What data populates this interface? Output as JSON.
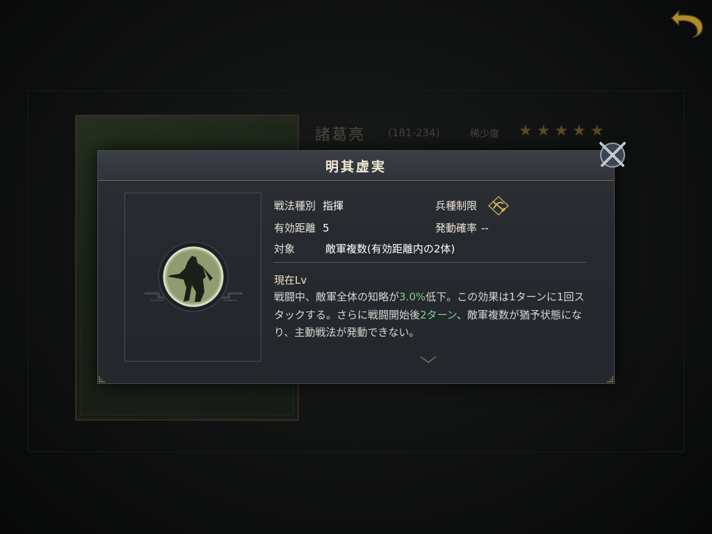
{
  "background": {
    "hero_name": "諸葛亮",
    "hero_years": "(181-234)",
    "rarity_label": "稀少度",
    "rarity_stars": "★★★★★"
  },
  "dialog": {
    "title": "明其虚実",
    "tactic_type": {
      "label": "戦法種別",
      "value": "指揮"
    },
    "troop_limit": {
      "label": "兵種制限",
      "icon": "crossbow-troop-icon"
    },
    "range": {
      "label": "有効距離",
      "value": "5"
    },
    "activation_rate": {
      "label": "発動確率",
      "value": "--"
    },
    "target": {
      "label": "対象",
      "value": "敵軍複数(有効距離内の2体)"
    },
    "level_label": "現在Lv",
    "description": {
      "p1": "戦闘中、敵軍全体の知略が",
      "h1": "3.0%",
      "p2": "低下。この効果は1ターンに1回スタックする。さらに戦闘開始後",
      "h2": "2ターン",
      "p3": "、敵軍複数が猶予状態になり、主動戦法が発動できない。"
    }
  },
  "colors": {
    "highlight": "#7fcf86",
    "gold": "#c9a656",
    "title": "#f2e9d4"
  }
}
